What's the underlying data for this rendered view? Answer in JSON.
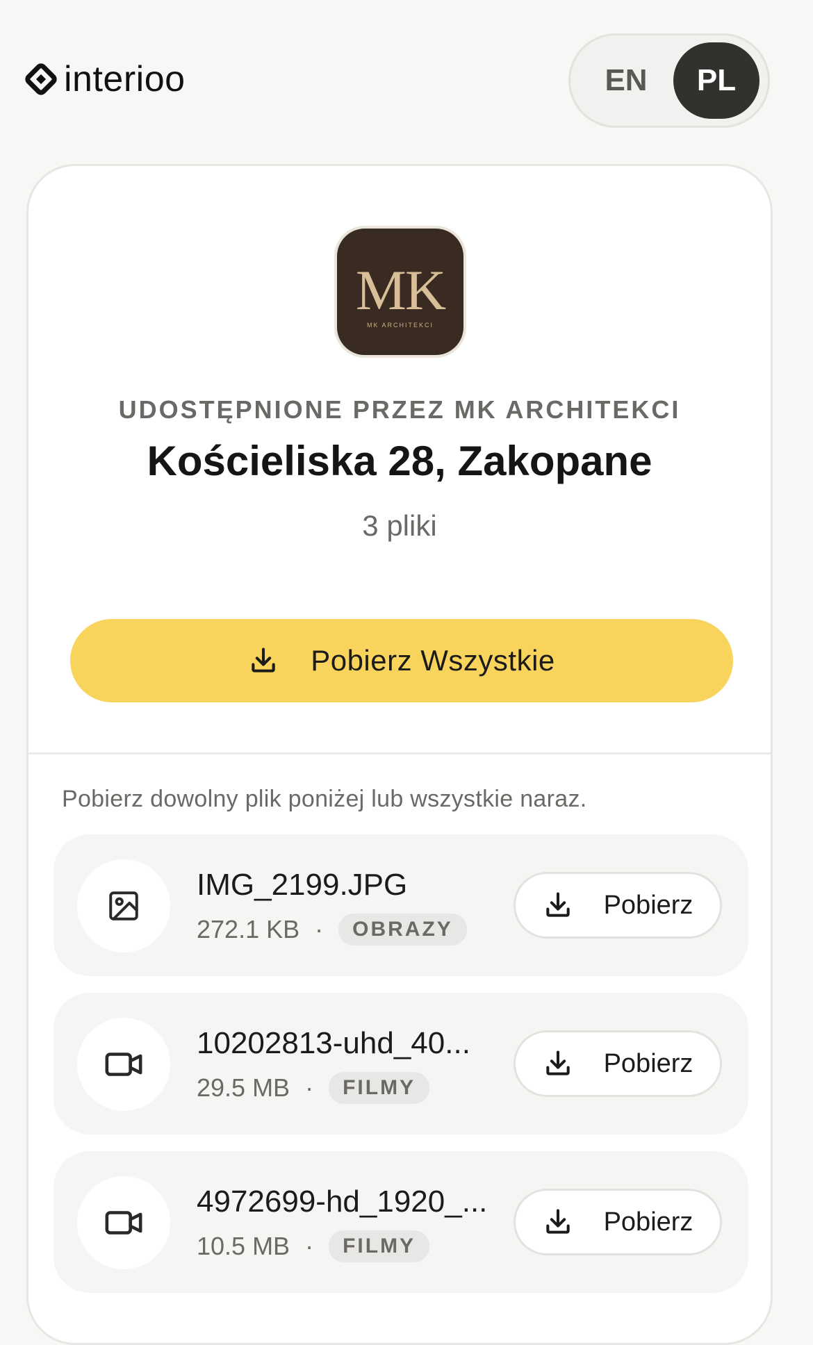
{
  "header": {
    "logo_text": "interioo",
    "languages": [
      {
        "code": "EN",
        "active": false
      },
      {
        "code": "PL",
        "active": true
      }
    ]
  },
  "share": {
    "brand_initials": "MK",
    "brand_subtitle": "MK ARCHITEKCI",
    "shared_by": "UDOSTĘPNIONE PRZEZ MK ARCHITEKCI",
    "title": "Kościeliska 28, Zakopane",
    "file_count": "3 pliki",
    "download_all_label": "Pobierz Wszystkie",
    "hint": "Pobierz dowolny plik poniżej lub wszystkie naraz."
  },
  "files": [
    {
      "name": "IMG_2199.JPG",
      "size": "272.1 KB",
      "type": "OBRAZY",
      "icon": "image-icon",
      "download_label": "Pobierz"
    },
    {
      "name": "10202813-uhd_40...",
      "size": "29.5 MB",
      "type": "FILMY",
      "icon": "video-icon",
      "download_label": "Pobierz"
    },
    {
      "name": "4972699-hd_1920_...",
      "size": "10.5 MB",
      "type": "FILMY",
      "icon": "video-icon",
      "download_label": "Pobierz"
    }
  ],
  "colors": {
    "accent": "#f9d45c",
    "brand_logo_bg": "#3a2b22",
    "brand_logo_text": "#d8bf98",
    "active_lang_bg": "#33312e"
  }
}
